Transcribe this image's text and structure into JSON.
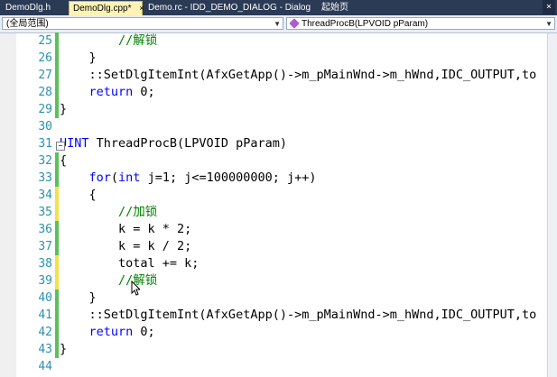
{
  "tabs": [
    {
      "label": "DemoDlg.h",
      "active": false
    },
    {
      "label": "DemoDlg.cpp*",
      "active": true
    },
    {
      "label": "Demo.rc - IDD_DEMO_DIALOG - Dialog",
      "active": false
    },
    {
      "label": "起始页",
      "active": false
    }
  ],
  "tab_close": "×",
  "nav": {
    "scope": "(全局范围)",
    "function": "ThreadProcB(LPVOID pParam)"
  },
  "lines": [
    {
      "num": "25",
      "text": "        //解锁",
      "mark": "green"
    },
    {
      "num": "26",
      "text": "    }",
      "mark": "green"
    },
    {
      "num": "27",
      "text": "    ::SetDlgItemInt(AfxGetApp()->m_pMainWnd->m_hWnd,IDC_OUTPUT,to",
      "mark": "green"
    },
    {
      "num": "28",
      "text": "    return 0;",
      "mark": "green"
    },
    {
      "num": "29",
      "text": "}",
      "mark": "green"
    },
    {
      "num": "30",
      "text": "",
      "mark": "none"
    },
    {
      "num": "31",
      "text": "UINT ThreadProcB(LPVOID pParam)",
      "mark": "none"
    },
    {
      "num": "32",
      "text": "{",
      "mark": "green"
    },
    {
      "num": "33",
      "text": "    for(int j=1; j<=100000000; j++)",
      "mark": "green"
    },
    {
      "num": "34",
      "text": "    {",
      "mark": "yellow"
    },
    {
      "num": "35",
      "text": "        //加锁",
      "mark": "yellow"
    },
    {
      "num": "36",
      "text": "        k = k * 2;",
      "mark": "green"
    },
    {
      "num": "37",
      "text": "        k = k / 2;",
      "mark": "green"
    },
    {
      "num": "38",
      "text": "        total += k;",
      "mark": "yellow"
    },
    {
      "num": "39",
      "text": "        //解锁",
      "mark": "yellow"
    },
    {
      "num": "40",
      "text": "    }",
      "mark": "green"
    },
    {
      "num": "41",
      "text": "    ::SetDlgItemInt(AfxGetApp()->m_pMainWnd->m_hWnd,IDC_OUTPUT,to",
      "mark": "green"
    },
    {
      "num": "42",
      "text": "    return 0;",
      "mark": "green"
    },
    {
      "num": "43",
      "text": "}",
      "mark": "green"
    },
    {
      "num": "44",
      "text": "",
      "mark": "none"
    }
  ],
  "colors": {
    "green": "#5cbf5c",
    "yellow": "#f4e04d",
    "keyword": "#0000ff",
    "comment": "#008000",
    "linenum": "#2b91af"
  }
}
